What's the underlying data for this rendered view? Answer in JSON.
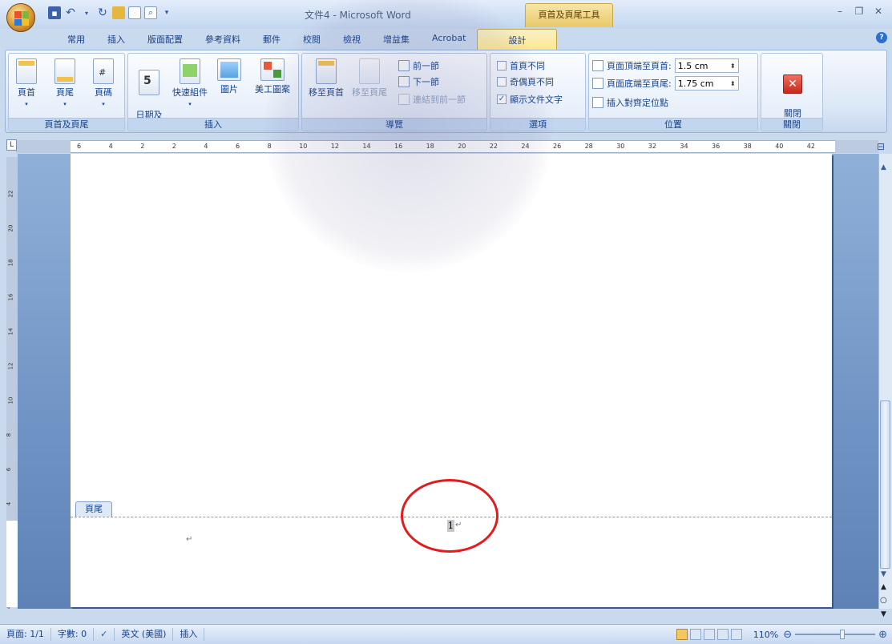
{
  "titlebar": {
    "document_title": "文件4 - Microsoft Word",
    "context_tools_title": "頁首及頁尾工具"
  },
  "tabs": [
    {
      "label": "常用"
    },
    {
      "label": "插入"
    },
    {
      "label": "版面配置"
    },
    {
      "label": "參考資料"
    },
    {
      "label": "郵件"
    },
    {
      "label": "校閱"
    },
    {
      "label": "檢視"
    },
    {
      "label": "增益集"
    },
    {
      "label": "Acrobat"
    },
    {
      "label": "設計"
    }
  ],
  "ribbon": {
    "header_footer": {
      "group_label": "頁首及頁尾",
      "header": "頁首",
      "footer": "頁尾",
      "page_number": "頁碼"
    },
    "insert": {
      "group_label": "插入",
      "datetime": "日期及\n時間",
      "quick_parts": "快速組件",
      "picture": "圖片",
      "clipart": "美工圖案"
    },
    "navigation": {
      "group_label": "導覽",
      "goto_header": "移至頁首",
      "goto_footer": "移至頁尾",
      "previous": "前一節",
      "next": "下一節",
      "link_previous": "連結到前一節"
    },
    "options": {
      "group_label": "選項",
      "different_first": "首頁不同",
      "different_odd_even": "奇偶頁不同",
      "show_text": "顯示文件文字",
      "different_first_checked": false,
      "different_odd_even_checked": false,
      "show_text_checked": true
    },
    "position": {
      "group_label": "位置",
      "header_top_label": "頁面頂端至頁首:",
      "header_top_value": "1.5 cm",
      "footer_bottom_label": "頁面底端至頁尾:",
      "footer_bottom_value": "1.75 cm",
      "insert_align_tab": "插入對齊定位點"
    },
    "close": {
      "group_label": "關閉",
      "close_label": "關閉\n頁首及頁尾"
    }
  },
  "ruler": {
    "corner": "L",
    "ticks": [
      "6",
      "4",
      "2",
      "2",
      "4",
      "6",
      "8",
      "10",
      "12",
      "14",
      "16",
      "18",
      "20",
      "22",
      "24",
      "26",
      "28",
      "30",
      "32",
      "34",
      "36",
      "38",
      "40",
      "42"
    ],
    "vticks": [
      "22",
      "20",
      "18",
      "16",
      "14",
      "12",
      "10",
      "8",
      "6",
      "4",
      "2",
      "2",
      "4"
    ]
  },
  "document": {
    "footer_tab": "頁尾",
    "page_number": "1"
  },
  "statusbar": {
    "page": "頁面: 1/1",
    "words": "字數: 0",
    "language": "英文 (美國)",
    "mode": "插入",
    "zoom": "110%"
  },
  "colors": {
    "annotation_circle": "#e21c1c",
    "ribbon_accent": "#15428b",
    "context_tab": "#ffe88e"
  }
}
